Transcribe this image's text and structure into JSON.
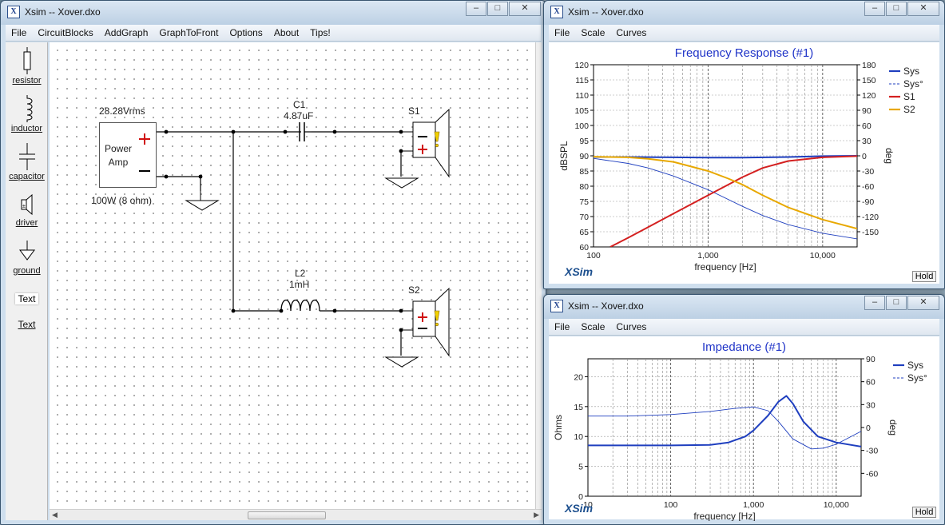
{
  "main_window": {
    "title": "Xsim -- Xover.dxo",
    "menu": [
      "File",
      "CircuitBlocks",
      "AddGraph",
      "GraphToFront",
      "Options",
      "About",
      "Tips!"
    ]
  },
  "palette": [
    {
      "label": "resistor",
      "icon": "resistor-icon"
    },
    {
      "label": "inductor",
      "icon": "inductor-icon"
    },
    {
      "label": "capacitor",
      "icon": "capacitor-icon"
    },
    {
      "label": "driver",
      "icon": "driver-icon"
    },
    {
      "label": "ground",
      "icon": "ground-icon"
    },
    {
      "label": "Text",
      "icon": "text-tool"
    },
    {
      "label": "Text",
      "icon": "text-link"
    }
  ],
  "schematic": {
    "source_voltage": "28.28Vrms",
    "amp_label_1": "Power",
    "amp_label_2": "Amp",
    "amp_rating": "100W (8 ohm)",
    "c1_name": "C1",
    "c1_value": "4.87uF",
    "l2_name": "L2",
    "l2_value": "1mH",
    "s1_name": "S1",
    "s2_name": "S2"
  },
  "window_controls": {
    "minimize": "–",
    "maximize": "□",
    "close": "✕"
  },
  "freq_window": {
    "title": "Xsim -- Xover.dxo",
    "menu": [
      "File",
      "Scale",
      "Curves"
    ],
    "plot_title": "Frequency Response (#1)",
    "logo": "XSim",
    "hold": "Hold"
  },
  "imp_window": {
    "title": "Xsim -- Xover.dxo",
    "menu": [
      "File",
      "Scale",
      "Curves"
    ],
    "plot_title": "Impedance (#1)",
    "logo": "XSim",
    "hold": "Hold"
  },
  "chart_data": [
    {
      "type": "line",
      "title": "Frequency Response (#1)",
      "xlabel": "frequency [Hz]",
      "ylabel": "dBSPL",
      "y2label": "deg",
      "xscale": "log",
      "xlim": [
        100,
        20000
      ],
      "ylim": [
        60,
        120
      ],
      "y2lim": [
        -180,
        180
      ],
      "x_tick_labels": [
        "100",
        "1,000",
        "10,000"
      ],
      "y_tick_labels": [
        "120",
        "115",
        "110",
        "105",
        "100",
        "95",
        "90",
        "85",
        "80",
        "75",
        "70",
        "65",
        "60"
      ],
      "y2_tick_labels": [
        "180",
        "150",
        "120",
        "90",
        "60",
        "30",
        "0",
        "-30",
        "-60",
        "-90",
        "-120",
        "-150"
      ],
      "grid": true,
      "legend_position": "right",
      "series": [
        {
          "name": "Sys",
          "axis": "left",
          "color": "#1f3fbf",
          "style": "solid",
          "x": [
            100,
            200,
            500,
            1000,
            2000,
            5000,
            10000,
            20000
          ],
          "y": [
            89.6,
            89.6,
            89.5,
            89.4,
            89.4,
            89.6,
            89.9,
            90.0
          ]
        },
        {
          "name": "Sys°",
          "axis": "right",
          "color": "#1f3fbf",
          "style": "thin",
          "x": [
            100,
            200,
            300,
            500,
            1000,
            2000,
            3000,
            5000,
            10000,
            20000
          ],
          "y": [
            -5,
            -15,
            -24,
            -40,
            -67,
            -100,
            -118,
            -136,
            -153,
            -164
          ]
        },
        {
          "name": "S1",
          "axis": "left",
          "color": "#d42020",
          "style": "solid",
          "x": [
            140,
            200,
            300,
            500,
            1000,
            2000,
            3000,
            5000,
            10000,
            20000
          ],
          "y": [
            60,
            63,
            66.5,
            71,
            77,
            83,
            86,
            88.3,
            89.5,
            89.9
          ]
        },
        {
          "name": "S2",
          "axis": "left",
          "color": "#e8a800",
          "style": "solid",
          "x": [
            100,
            200,
            300,
            500,
            1000,
            1500,
            2000,
            3000,
            5000,
            10000,
            20000
          ],
          "y": [
            89.7,
            89.5,
            89,
            88,
            85,
            82.5,
            80.5,
            77,
            73,
            69,
            66
          ]
        }
      ]
    },
    {
      "type": "line",
      "title": "Impedance (#1)",
      "xlabel": "frequency [Hz]",
      "ylabel": "Ohms",
      "y2label": "deg",
      "xscale": "log",
      "xlim": [
        10,
        20000
      ],
      "ylim": [
        0,
        23
      ],
      "y2lim": [
        -90,
        90
      ],
      "x_tick_labels": [
        "10",
        "100",
        "1,000",
        "10,000"
      ],
      "y_tick_labels": [
        "20",
        "15",
        "10",
        "5",
        "0"
      ],
      "y2_tick_labels": [
        "90",
        "60",
        "30",
        "0",
        "-30",
        "-60"
      ],
      "grid": true,
      "legend_position": "right",
      "series": [
        {
          "name": "Sys",
          "axis": "left",
          "color": "#1f3fbf",
          "style": "solid",
          "x": [
            10,
            50,
            100,
            300,
            500,
            800,
            1000,
            1500,
            2000,
            2500,
            3000,
            4000,
            6000,
            10000,
            20000
          ],
          "y": [
            8.5,
            8.5,
            8.5,
            8.6,
            9.0,
            10.0,
            11.0,
            13.5,
            15.8,
            16.8,
            15.5,
            12.5,
            10.0,
            9.0,
            8.3
          ]
        },
        {
          "name": "Sys°",
          "axis": "right",
          "color": "#1f3fbf",
          "style": "thin",
          "x": [
            10,
            30,
            100,
            300,
            600,
            1000,
            1500,
            2000,
            3000,
            5000,
            7000,
            10000,
            20000
          ],
          "y": [
            15,
            15,
            17,
            21,
            25,
            27,
            22,
            8,
            -15,
            -28,
            -27,
            -22,
            -5
          ]
        }
      ]
    }
  ]
}
